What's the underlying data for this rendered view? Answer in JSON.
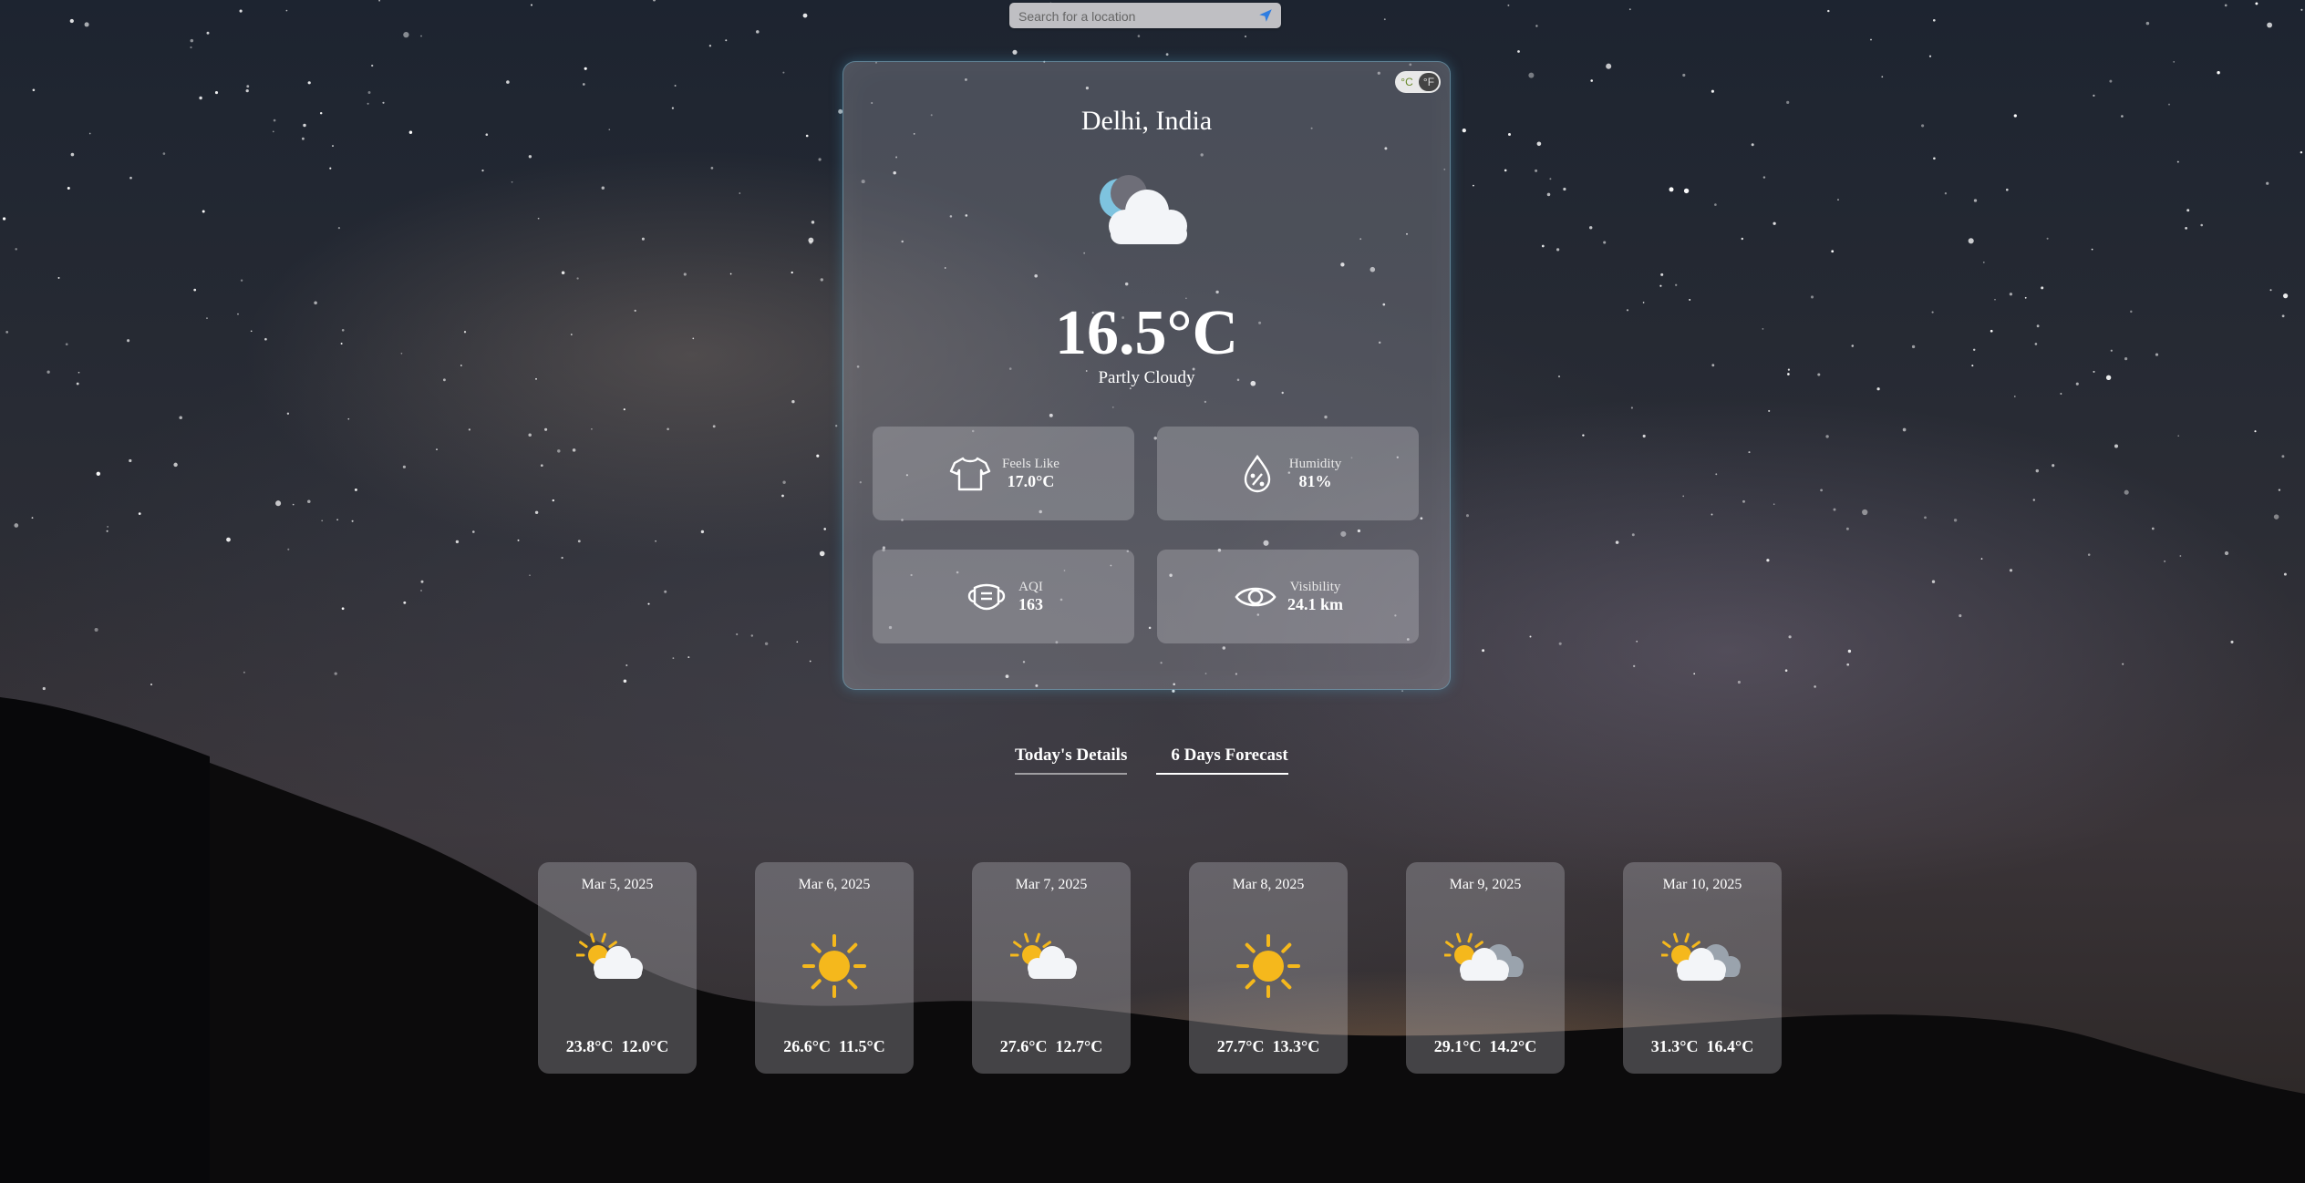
{
  "search": {
    "placeholder": "Search for a location",
    "icon": "location-arrow-icon"
  },
  "unit_toggle": {
    "celsius_label": "°C",
    "fahrenheit_label": "°F"
  },
  "current": {
    "location": "Delhi, India",
    "icon": "moon-cloud-icon",
    "temperature": "16.5°C",
    "condition": "Partly Cloudy",
    "stats": [
      {
        "icon": "shirt-icon",
        "label": "Feels Like",
        "value": "17.0°C"
      },
      {
        "icon": "humidity-drop-icon",
        "label": "Humidity",
        "value": "81%"
      },
      {
        "icon": "mask-icon",
        "label": "AQI",
        "value": "163"
      },
      {
        "icon": "eye-icon",
        "label": "Visibility",
        "value": "24.1 km"
      }
    ]
  },
  "tabs": [
    {
      "label": "Today's Details"
    },
    {
      "label": "6 Days Forecast"
    }
  ],
  "forecast": [
    {
      "date": "Mar 5, 2025",
      "icon": "sun-cloud-icon",
      "high": "23.8°C",
      "low": "12.0°C"
    },
    {
      "date": "Mar 6, 2025",
      "icon": "sun-icon",
      "high": "26.6°C",
      "low": "11.5°C"
    },
    {
      "date": "Mar 7, 2025",
      "icon": "sun-cloud-icon",
      "high": "27.6°C",
      "low": "12.7°C"
    },
    {
      "date": "Mar 8, 2025",
      "icon": "sun-icon",
      "high": "27.7°C",
      "low": "13.3°C"
    },
    {
      "date": "Mar 9, 2025",
      "icon": "sun-clouds-icon",
      "high": "29.1°C",
      "low": "14.2°C"
    },
    {
      "date": "Mar 10, 2025",
      "icon": "sun-clouds-icon",
      "high": "31.3°C",
      "low": "16.4°C"
    }
  ],
  "colors": {
    "card_border": "#6fbad6",
    "sun": "#f5b81c",
    "location_icon": "#2f7de1"
  }
}
